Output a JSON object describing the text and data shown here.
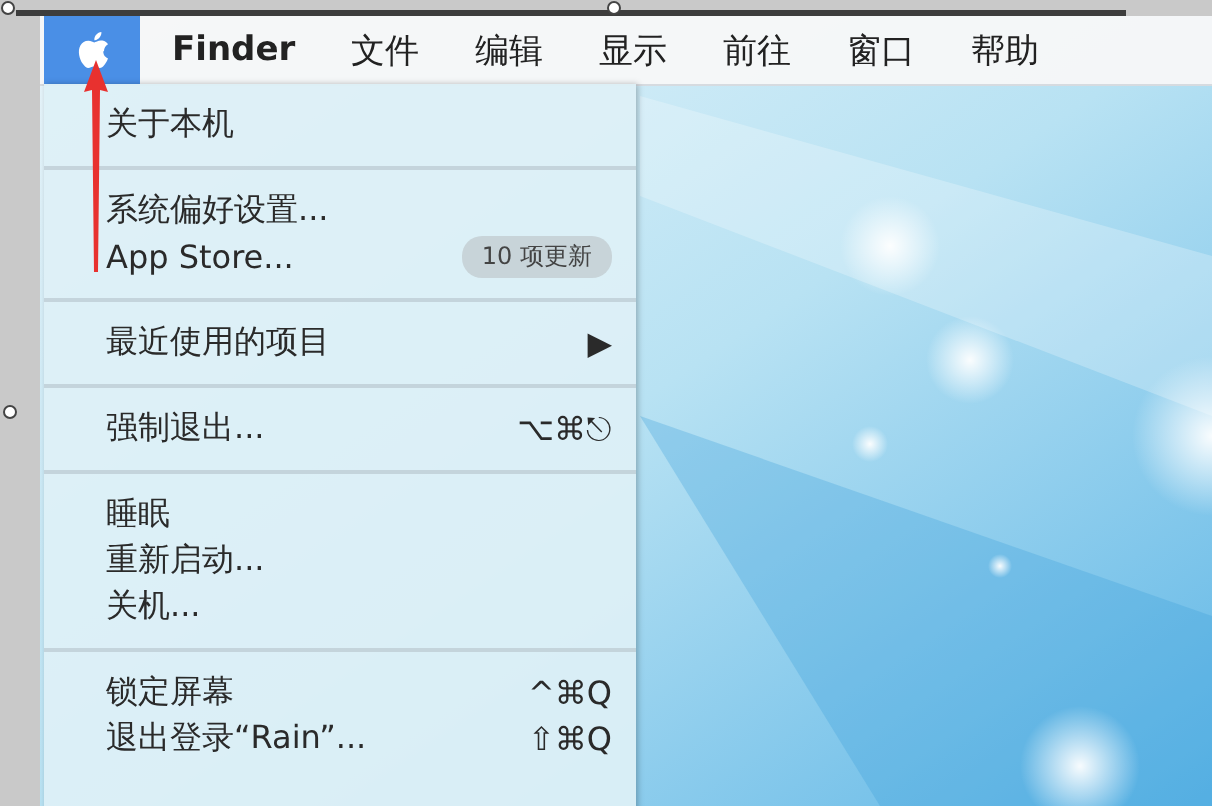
{
  "menu_bar": {
    "apple_selected": true,
    "items": [
      {
        "label": "Finder",
        "bold": true
      },
      {
        "label": "文件",
        "bold": false
      },
      {
        "label": "编辑",
        "bold": false
      },
      {
        "label": "显示",
        "bold": false
      },
      {
        "label": "前往",
        "bold": false
      },
      {
        "label": "窗口",
        "bold": false
      },
      {
        "label": "帮助",
        "bold": false
      }
    ]
  },
  "apple_menu": {
    "groups": [
      [
        {
          "label": "关于本机"
        }
      ],
      [
        {
          "label": "系统偏好设置..."
        },
        {
          "label": "App Store...",
          "badge": "10 项更新"
        }
      ],
      [
        {
          "label": "最近使用的项目",
          "submenu": "▶"
        }
      ],
      [
        {
          "label": "强制退出...",
          "shortcut": "⌥⌘⎋"
        }
      ],
      [
        {
          "label": "睡眠"
        },
        {
          "label": "重新启动..."
        },
        {
          "label": "关机..."
        }
      ],
      [
        {
          "label": "锁定屏幕",
          "shortcut": "^⌘Q"
        },
        {
          "label": "退出登录“Rain”...",
          "shortcut": "⇧⌘Q"
        }
      ]
    ]
  }
}
